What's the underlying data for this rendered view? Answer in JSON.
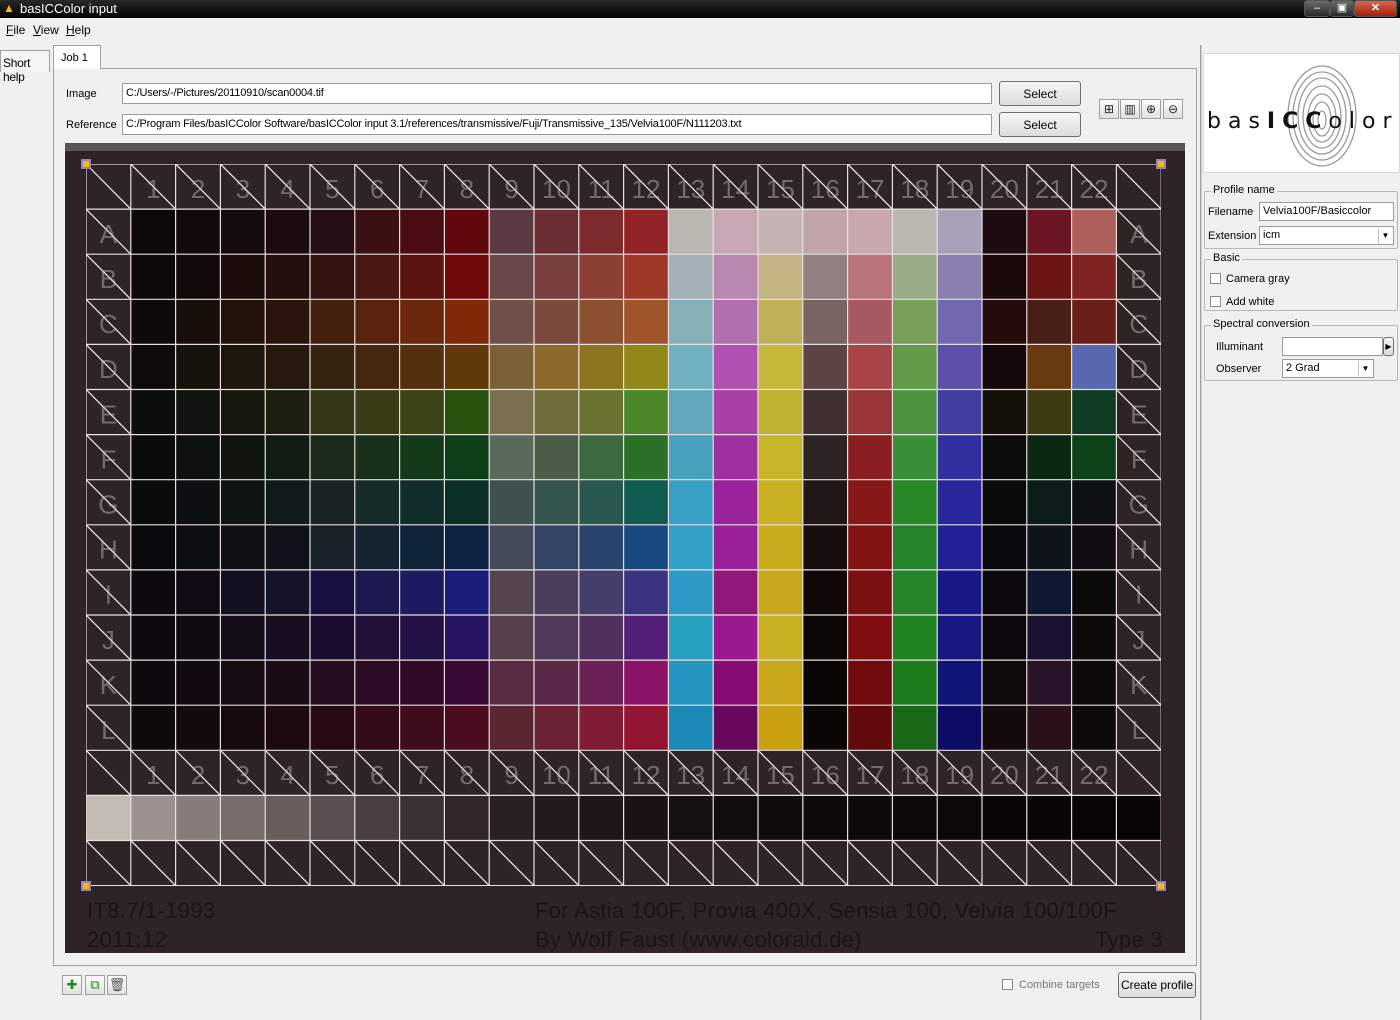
{
  "window": {
    "title": "basICColor input"
  },
  "menu": [
    {
      "key": "F",
      "rest": "ile"
    },
    {
      "key": "V",
      "rest": "iew"
    },
    {
      "key": "H",
      "rest": "elp"
    }
  ],
  "tabs": {
    "short_help": "Short help",
    "job": "Job 1"
  },
  "job": {
    "image_label": "Image",
    "image_path": "C:/Users/-/Pictures/20110910/scan0004.tif",
    "reference_label": "Reference",
    "reference_path": "C:/Program Files/basICColor Software/basICColor input 3.1/references/transmissive/Fuji/Transmissive_135/Velvia100F/N111203.txt",
    "select_label": "Select"
  },
  "target": {
    "caption_left_1": "IT8.7/1-1993",
    "caption_left_2": "2011:12",
    "caption_right_1": "For Astia 100F, Provia 400X, Sensia 100, Velvia 100/100F",
    "caption_right_2": "By Wolf Faust (www.coloraid.de)",
    "caption_type": "Type 3",
    "columns": [
      "1",
      "2",
      "3",
      "4",
      "5",
      "6",
      "7",
      "8",
      "9",
      "10",
      "11",
      "12",
      "13",
      "14",
      "15",
      "16",
      "17",
      "18",
      "19",
      "20",
      "21",
      "22"
    ],
    "rows": [
      "A",
      "B",
      "C",
      "D",
      "E",
      "F",
      "G",
      "H",
      "I",
      "J",
      "K",
      "L"
    ],
    "patch_colors": [
      [
        "#0c0809",
        "#120a0a",
        "#150b0b",
        "#1c0b0c",
        "#260f12",
        "#3a1013",
        "#4a0c12",
        "#60080e",
        "#5a3a40",
        "#6a2e33",
        "#7d2a2e",
        "#922428",
        "#b8b8b0",
        "#c8a8b4",
        "#c4b4b4",
        "#c0a4a8",
        "#c8a8ac",
        "#b8b8b0",
        "#a8a0b8",
        "#1c0c0e",
        "#6a1424",
        "#b0605c"
      ],
      [
        "#0d0908",
        "#140a09",
        "#1c0c0a",
        "#240e0c",
        "#341410",
        "#4a1812",
        "#5c1410",
        "#700a0a",
        "#6a484a",
        "#7a4040",
        "#8c4034",
        "#a0382a",
        "#a4b0b8",
        "#b888b0",
        "#c4b484",
        "#908080",
        "#b87478",
        "#98ac88",
        "#8a80b0",
        "#1c0a0a",
        "#6a1414",
        "#802424"
      ],
      [
        "#0e0a08",
        "#180e0a",
        "#22120a",
        "#2a140c",
        "#44200e",
        "#58240e",
        "#6c280c",
        "#802a08",
        "#6e5048",
        "#7c4a3c",
        "#8c5030",
        "#a0542a",
        "#88b0b8",
        "#b070b0",
        "#c0b058",
        "#786460",
        "#a85860",
        "#78a058",
        "#7068b0",
        "#240c0c",
        "#482018",
        "#6a2018"
      ],
      [
        "#0e0c0a",
        "#16120c",
        "#1e160c",
        "#26180c",
        "#362410",
        "#44280e",
        "#54300c",
        "#60380a",
        "#7c6038",
        "#8c6a2c",
        "#8e7420",
        "#908818",
        "#70b0c0",
        "#b050b0",
        "#c8b83a",
        "#5c4444",
        "#a84448",
        "#609c48",
        "#5c50a8",
        "#140808",
        "#683a10",
        "#5868b0"
      ],
      [
        "#0c0e0c",
        "#121410",
        "#16180e",
        "#1c1e10",
        "#343618",
        "#3a3c16",
        "#3a4414",
        "#285410",
        "#7a7050",
        "#706c3c",
        "#6a7430",
        "#4a8828",
        "#60a8bc",
        "#a840a8",
        "#c0b030",
        "#403030",
        "#983638",
        "#4c9440",
        "#4040a0",
        "#121008",
        "#3c3c10",
        "#103c24"
      ],
      [
        "#0a0c0c",
        "#0e120e",
        "#10160e",
        "#121c12",
        "#1c2a1c",
        "#183018",
        "#143a1a",
        "#0c4018",
        "#5a6a5a",
        "#4a5e48",
        "#3e6a40",
        "#2a7028",
        "#48a0bc",
        "#a030a0",
        "#c8b428",
        "#2c2424",
        "#8a1e20",
        "#3a9038",
        "#3030a0",
        "#0c0c0a",
        "#0c2812",
        "#0c4218"
      ],
      [
        "#0a0c0c",
        "#0c1010",
        "#0e1412",
        "#101a18",
        "#1a2424",
        "#162c28",
        "#122e2c",
        "#0c3028",
        "#3e5050",
        "#345450",
        "#285850",
        "#105c50",
        "#38a0c4",
        "#9a249c",
        "#c8b020",
        "#201818",
        "#881818",
        "#288828",
        "#28289c",
        "#0a0c0c",
        "#0c1c18",
        "#0e1014"
      ],
      [
        "#0a0a0c",
        "#0c0e12",
        "#0e1016",
        "#10121a",
        "#182028",
        "#142430",
        "#102438",
        "#0c2240",
        "#444a5a",
        "#344466",
        "#2a446e",
        "#184a80",
        "#30a0c8",
        "#9a209c",
        "#c8ac1c",
        "#180e0e",
        "#841414",
        "#24842a",
        "#202094",
        "#0a0a0c",
        "#0c141c",
        "#100c12"
      ],
      [
        "#0c0a0e",
        "#100c16",
        "#12101e",
        "#141428",
        "#181040",
        "#1c1850",
        "#1c1a60",
        "#1a1c7a",
        "#544450",
        "#4a3e5a",
        "#443e6a",
        "#3a3480",
        "#2c9ac4",
        "#901878",
        "#c8a81c",
        "#100808",
        "#7a1010",
        "#248428",
        "#181888",
        "#0c0a0c",
        "#0e1830",
        "#0a0a0a"
      ],
      [
        "#0c0a0e",
        "#100a12",
        "#140c18",
        "#180e20",
        "#1c0c30",
        "#221038",
        "#241246",
        "#281262",
        "#56404c",
        "#503858",
        "#50305e",
        "#521e78",
        "#28a0c0",
        "#9a1890",
        "#c8b020",
        "#0c0606",
        "#800e10",
        "#208420",
        "#181882",
        "#0c080c",
        "#1a1030",
        "#0c0a0a"
      ],
      [
        "#0c0a0c",
        "#120a0e",
        "#160c12",
        "#1a0c16",
        "#260c20",
        "#2c0c24",
        "#320a28",
        "#3a0a34",
        "#5a2c44",
        "#5c2848",
        "#6c2058",
        "#8c1468",
        "#2496c0",
        "#880c74",
        "#c8a818",
        "#0a0606",
        "#700c0e",
        "#1c7c1c",
        "#101474",
        "#100a0c",
        "#281428",
        "#0c0a0a"
      ],
      [
        "#0c0a0a",
        "#120a0c",
        "#160a0e",
        "#1c0a10",
        "#280a14",
        "#340c18",
        "#3e0c1a",
        "#4a0c1e",
        "#5a2630",
        "#6a2234",
        "#801c34",
        "#921634",
        "#1c8ab8",
        "#68085c",
        "#c8a010",
        "#0a0606",
        "#600a0c",
        "#186818",
        "#0c0c64",
        "#140a0a",
        "#2a1018",
        "#0c0a0a"
      ]
    ],
    "gray_row": [
      "#c4bab4",
      "#9c908e",
      "#887c7a",
      "#7a6e6c",
      "#6a5e5c",
      "#5a4e4e",
      "#4a3e40",
      "#3c3234",
      "#322628",
      "#2a2022",
      "#241a1c",
      "#1e1618",
      "#1a1214",
      "#161012",
      "#120c0e",
      "#100c0c",
      "#0e0a0a",
      "#0c0a0a",
      "#0a0808",
      "#0a0808",
      "#080606",
      "#080606",
      "#060404",
      "#060404"
    ]
  },
  "toolbar": {
    "icons": [
      "fit-window-icon",
      "fit-width-icon",
      "zoom-in-icon",
      "zoom-out-icon"
    ]
  },
  "bottom": {
    "combine_targets_label": "Combine targets",
    "create_profile_label": "Create profile"
  },
  "right_panel": {
    "logo_text_a": "bas",
    "logo_text_b": "ICC",
    "logo_text_c": "olor",
    "profile_name_title": "Profile name",
    "filename_label": "Filename",
    "filename_value": "Velvia100F/Basiccolor",
    "extension_label": "Extension",
    "extension_value": "icm",
    "basic_title": "Basic",
    "camera_gray_label": "Camera gray",
    "add_white_label": "Add white",
    "spectral_title": "Spectral conversion",
    "illuminant_label": "Illuminant",
    "illuminant_value": "",
    "observer_label": "Observer",
    "observer_value": "2 Grad"
  },
  "colors": {
    "target_bg": "#2e2425",
    "grid_line": "#e8e0e0",
    "corner_handle": "#f0c000"
  }
}
